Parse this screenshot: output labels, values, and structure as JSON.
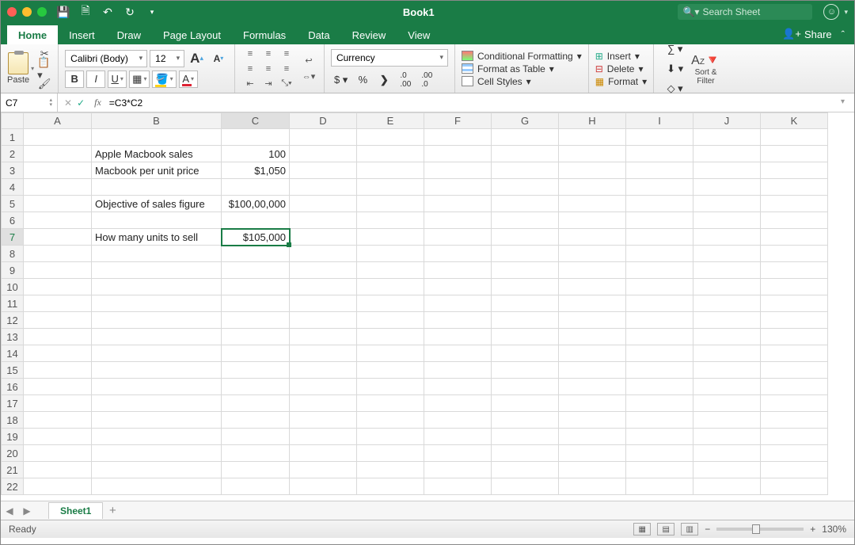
{
  "window": {
    "title": "Book1",
    "search_placeholder": "Search Sheet"
  },
  "tabs": [
    "Home",
    "Insert",
    "Draw",
    "Page Layout",
    "Formulas",
    "Data",
    "Review",
    "View"
  ],
  "share_label": "Share",
  "ribbon": {
    "paste_label": "Paste",
    "font_name": "Calibri (Body)",
    "font_size": "12",
    "number_format": "Currency",
    "cond_fmt": "Conditional Formatting",
    "fmt_table": "Format as Table",
    "cell_styles": "Cell Styles",
    "insert": "Insert",
    "delete": "Delete",
    "format": "Format",
    "sortfilter": "Sort &\nFilter"
  },
  "formula_bar": {
    "cell_ref": "C7",
    "formula": "=C3*C2"
  },
  "columns": [
    "A",
    "B",
    "C",
    "D",
    "E",
    "F",
    "G",
    "H",
    "I",
    "J",
    "K"
  ],
  "rows_count": 22,
  "cells": {
    "B2": "Apple Macbook sales",
    "C2": "100",
    "B3": "Macbook per unit price",
    "C3": "$1,050",
    "B5": "Objective of sales figure",
    "C5": "$100,00,000",
    "B7": "How many units to sell",
    "C7": "$105,000"
  },
  "selected_cell": "C7",
  "sheet_tab": "Sheet1",
  "status_text": "Ready",
  "zoom": "130%"
}
